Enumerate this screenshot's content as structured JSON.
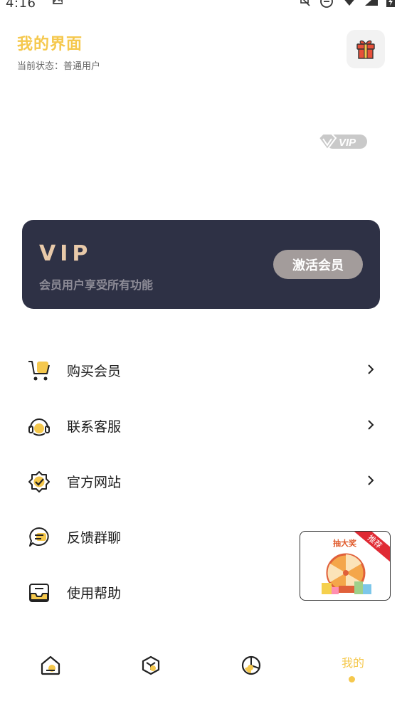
{
  "status_bar": {
    "time": "4:16",
    "icons": [
      "image-icon",
      "bell-off-icon",
      "dnd-icon",
      "wifi-icon",
      "signal-icon",
      "battery-icon"
    ]
  },
  "header": {
    "title": "我的界面",
    "status": "当前状态：普通用户"
  },
  "gift": {
    "icon": "gift-icon"
  },
  "badge": {
    "text": "VIP"
  },
  "vip_card": {
    "title": "VIP",
    "subtitle": "会员用户享受所有功能",
    "button_label": "激活会员"
  },
  "menu": {
    "items": [
      {
        "label": "购买会员",
        "icon": "cart-icon",
        "has_arrow": true
      },
      {
        "label": "联系客服",
        "icon": "customer-service-icon",
        "has_arrow": true
      },
      {
        "label": "官方网站",
        "icon": "verified-badge-icon",
        "has_arrow": true
      },
      {
        "label": "反馈群聊",
        "icon": "chat-bubble-icon",
        "has_arrow": false
      },
      {
        "label": "使用帮助",
        "icon": "inbox-icon",
        "has_arrow": false
      }
    ]
  },
  "promo": {
    "title": "抽大奖",
    "tag": "推荐"
  },
  "bottom_nav": {
    "tabs": [
      "home-icon",
      "cube-icon",
      "pie-chart-icon"
    ],
    "active_label": "我的"
  },
  "colors": {
    "accent": "#f5c84d",
    "card_bg": "#2e3145",
    "vip_gold": "#e8c9a9",
    "button_bg": "#a39c9b"
  }
}
